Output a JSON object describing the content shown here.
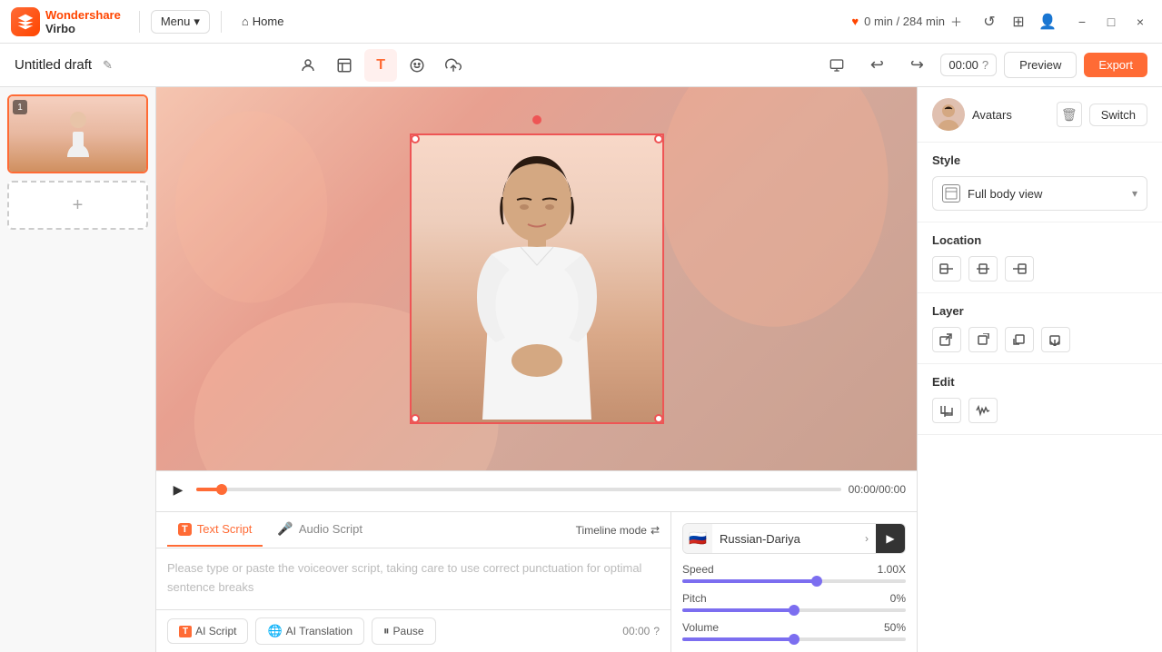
{
  "app": {
    "name": "Wondershare Virbo",
    "logo_text": "Virbo"
  },
  "topbar": {
    "menu_label": "Menu",
    "home_label": "Home",
    "time_info": "0 min / 284 min",
    "minimize_label": "−",
    "maximize_label": "□",
    "close_label": "×"
  },
  "secondbar": {
    "draft_title": "Untitled draft",
    "time_display": "00:00",
    "preview_label": "Preview",
    "export_label": "Export"
  },
  "left_panel": {
    "scene_number": "1",
    "add_scene_label": "+"
  },
  "timeline": {
    "time_counter": "00:00/00:00",
    "progress_percent": 4
  },
  "script": {
    "text_tab_label": "Text Script",
    "audio_tab_label": "Audio Script",
    "timeline_mode_label": "Timeline mode",
    "placeholder": "Please type or paste the voiceover script, taking care to use correct punctuation for optimal sentence breaks",
    "ai_script_label": "AI Script",
    "ai_translation_label": "AI Translation",
    "pause_label": "Pause",
    "time_label": "00:00",
    "help_icon": "?"
  },
  "voice": {
    "flag": "🇷🇺",
    "name": "Russian-Dariya",
    "speed_label": "Speed",
    "speed_value": "1.00X",
    "speed_percent": 60,
    "pitch_label": "Pitch",
    "pitch_value": "0%",
    "pitch_percent": 50,
    "volume_label": "Volume",
    "volume_value": "50%",
    "volume_percent": 50
  },
  "right_panel": {
    "avatars_label": "Avatars",
    "switch_label": "Switch",
    "style_section_label": "Style",
    "style_option": "Full body view",
    "location_label": "Location",
    "layer_label": "Layer",
    "edit_label": "Edit"
  }
}
